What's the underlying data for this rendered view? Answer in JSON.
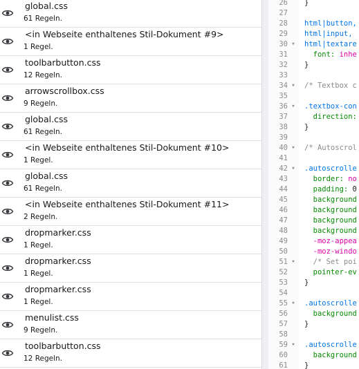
{
  "stylesheets": [
    {
      "name": "global.css",
      "count": "61 Regeln."
    },
    {
      "name": "<in Webseite enthaltenes Stil-Dokument #9>",
      "count": "1 Regel."
    },
    {
      "name": "toolbarbutton.css",
      "count": "12 Regeln."
    },
    {
      "name": "arrowscrollbox.css",
      "count": "9 Regeln."
    },
    {
      "name": "global.css",
      "count": "61 Regeln."
    },
    {
      "name": "<in Webseite enthaltenes Stil-Dokument #10>",
      "count": "1 Regel."
    },
    {
      "name": "global.css",
      "count": "61 Regeln."
    },
    {
      "name": "<in Webseite enthaltenes Stil-Dokument #11>",
      "count": "2 Regeln."
    },
    {
      "name": "dropmarker.css",
      "count": "1 Regel."
    },
    {
      "name": "dropmarker.css",
      "count": "1 Regel."
    },
    {
      "name": "dropmarker.css",
      "count": "1 Regel."
    },
    {
      "name": "menulist.css",
      "count": "9 Regeln."
    },
    {
      "name": "toolbarbutton.css",
      "count": "12 Regeln."
    }
  ],
  "editor": {
    "lines": [
      {
        "num": "26",
        "fold": "",
        "parts": [
          {
            "t": "}",
            "c": "plain"
          }
        ]
      },
      {
        "num": "27",
        "fold": "",
        "parts": []
      },
      {
        "num": "28",
        "fold": "",
        "parts": [
          {
            "t": "html|button,",
            "c": "sel"
          }
        ]
      },
      {
        "num": "29",
        "fold": "",
        "parts": [
          {
            "t": "html|input,",
            "c": "sel"
          }
        ]
      },
      {
        "num": "30",
        "fold": "▾",
        "parts": [
          {
            "t": "html|textare",
            "c": "sel"
          }
        ]
      },
      {
        "num": "31",
        "fold": "",
        "parts": [
          {
            "t": "  font: ",
            "c": "prop"
          },
          {
            "t": "inhe",
            "c": "val"
          }
        ]
      },
      {
        "num": "32",
        "fold": "",
        "parts": [
          {
            "t": "}",
            "c": "plain"
          }
        ]
      },
      {
        "num": "33",
        "fold": "",
        "parts": []
      },
      {
        "num": "34",
        "fold": "▾",
        "parts": [
          {
            "t": "/* Textbox c",
            "c": "com"
          }
        ]
      },
      {
        "num": "35",
        "fold": "",
        "parts": []
      },
      {
        "num": "36",
        "fold": "▾",
        "parts": [
          {
            "t": ".textbox-con",
            "c": "sel"
          }
        ]
      },
      {
        "num": "37",
        "fold": "",
        "parts": [
          {
            "t": "  direction:",
            "c": "prop"
          }
        ]
      },
      {
        "num": "38",
        "fold": "",
        "parts": [
          {
            "t": "}",
            "c": "plain"
          }
        ]
      },
      {
        "num": "39",
        "fold": "",
        "parts": []
      },
      {
        "num": "40",
        "fold": "▾",
        "parts": [
          {
            "t": "/* Autoscrol",
            "c": "com"
          }
        ]
      },
      {
        "num": "41",
        "fold": "",
        "parts": []
      },
      {
        "num": "42",
        "fold": "▾",
        "parts": [
          {
            "t": ".autoscrolle",
            "c": "sel"
          }
        ]
      },
      {
        "num": "43",
        "fold": "",
        "parts": [
          {
            "t": "  border: ",
            "c": "prop"
          },
          {
            "t": "no",
            "c": "val"
          }
        ]
      },
      {
        "num": "44",
        "fold": "",
        "parts": [
          {
            "t": "  padding: ",
            "c": "prop"
          },
          {
            "t": "0",
            "c": "plain"
          }
        ]
      },
      {
        "num": "45",
        "fold": "",
        "parts": [
          {
            "t": "  background",
            "c": "prop"
          }
        ]
      },
      {
        "num": "46",
        "fold": "",
        "parts": [
          {
            "t": "  background",
            "c": "prop"
          }
        ]
      },
      {
        "num": "47",
        "fold": "",
        "parts": [
          {
            "t": "  background",
            "c": "prop"
          }
        ]
      },
      {
        "num": "48",
        "fold": "",
        "parts": [
          {
            "t": "  background",
            "c": "prop"
          }
        ]
      },
      {
        "num": "49",
        "fold": "",
        "parts": [
          {
            "t": "  -moz-",
            "c": "val"
          },
          {
            "t": "appea",
            "c": "val"
          }
        ]
      },
      {
        "num": "50",
        "fold": "",
        "parts": [
          {
            "t": "  -moz-",
            "c": "val"
          },
          {
            "t": "windo",
            "c": "val"
          }
        ]
      },
      {
        "num": "51",
        "fold": "▾",
        "parts": [
          {
            "t": "  /* Set poi",
            "c": "com"
          }
        ]
      },
      {
        "num": "52",
        "fold": "",
        "parts": [
          {
            "t": "  pointer-ev",
            "c": "prop"
          }
        ]
      },
      {
        "num": "53",
        "fold": "",
        "parts": [
          {
            "t": "}",
            "c": "plain"
          }
        ]
      },
      {
        "num": "54",
        "fold": "",
        "parts": []
      },
      {
        "num": "55",
        "fold": "▾",
        "parts": [
          {
            "t": ".autoscrolle",
            "c": "sel"
          }
        ]
      },
      {
        "num": "56",
        "fold": "",
        "parts": [
          {
            "t": "  background",
            "c": "prop"
          }
        ]
      },
      {
        "num": "57",
        "fold": "",
        "parts": [
          {
            "t": "}",
            "c": "plain"
          }
        ]
      },
      {
        "num": "58",
        "fold": "",
        "parts": []
      },
      {
        "num": "59",
        "fold": "▾",
        "parts": [
          {
            "t": ".autoscrolle",
            "c": "sel"
          }
        ]
      },
      {
        "num": "60",
        "fold": "",
        "parts": [
          {
            "t": "  background",
            "c": "prop"
          }
        ]
      },
      {
        "num": "61",
        "fold": "",
        "parts": [
          {
            "t": "}",
            "c": "plain"
          }
        ]
      }
    ]
  },
  "colors": {
    "selector": "#0074e8",
    "property": "#058b00",
    "value": "#dd00a9",
    "comment": "#8a8a8f",
    "text": "#18181a"
  },
  "icons": {
    "visibility": "eye-icon"
  }
}
